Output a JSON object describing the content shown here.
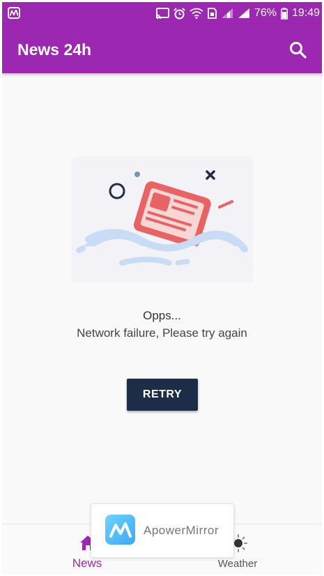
{
  "status_bar": {
    "battery": "76%",
    "time": "19:49"
  },
  "app_bar": {
    "title": "News 24h"
  },
  "error": {
    "title": "Opps...",
    "message": "Network failure, Please try again",
    "retry_label": "RETRY"
  },
  "bottom_nav": {
    "items": [
      {
        "label": "News",
        "icon": "home-icon",
        "active": true
      },
      {
        "label": "Weather",
        "icon": "weather-icon",
        "active": false
      }
    ]
  },
  "overlay": {
    "app_name": "ApowerMirror"
  },
  "colors": {
    "primary": "#9c27b0",
    "button": "#1e2d47",
    "illustration_red": "#e86464",
    "illustration_wave": "#c9dcf5"
  }
}
